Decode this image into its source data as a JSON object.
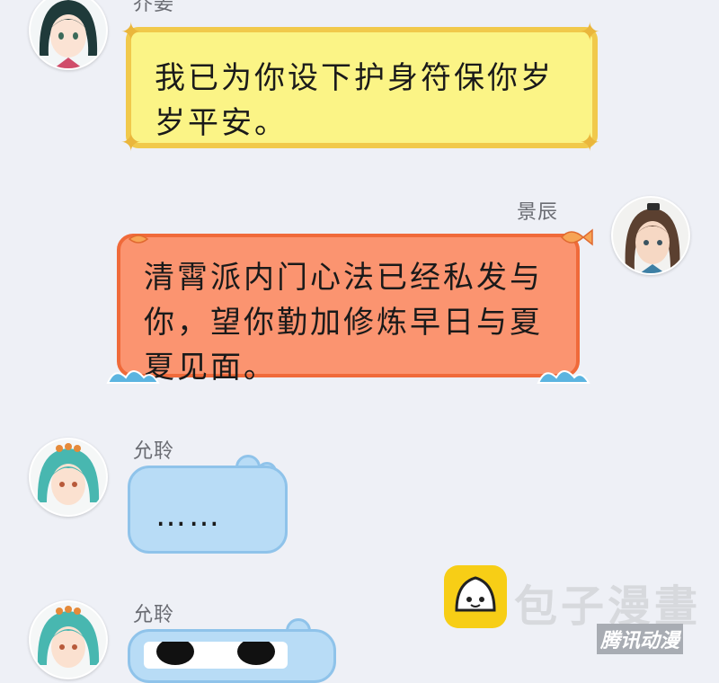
{
  "messages": [
    {
      "sender": "乔姜",
      "text": "我已为你设下护身符保你岁岁平安。",
      "lines": [
        "我已为你设下护身符保你岁",
        "岁平安。"
      ]
    },
    {
      "sender": "景辰",
      "text": "清霄派内门心法已经私发与你，望你勤加修炼早日与夏夏见面。",
      "lines": [
        "清霄派内门心法已经私发与",
        "你，望你勤加修炼早日与夏",
        "夏见面。"
      ]
    },
    {
      "sender": "允聆",
      "text": "……"
    },
    {
      "sender": "允聆",
      "text": ""
    }
  ],
  "watermark": {
    "title": "包子漫畫",
    "subtitle": "腾讯动漫"
  },
  "colors": {
    "background": "#eef0f6",
    "bubble_yellow": "#fbf486",
    "bubble_orange": "#fb9470",
    "bubble_blue": "#b8dcf6",
    "logo_yellow": "#f7ce16"
  }
}
